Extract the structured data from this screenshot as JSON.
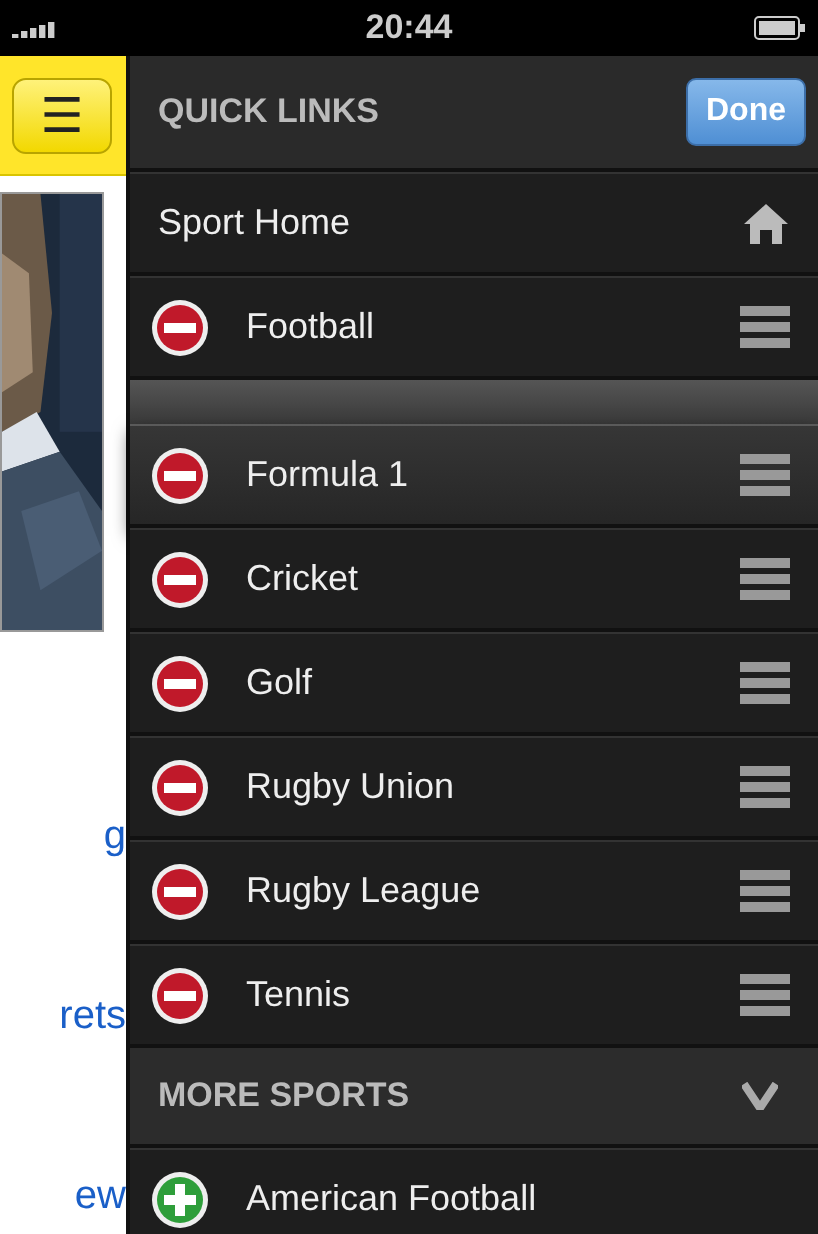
{
  "status_bar": {
    "time": "20:44"
  },
  "left_page": {
    "menu_button": "☰",
    "links": [
      "g",
      "rets",
      "ew"
    ]
  },
  "quick_links": {
    "title": "QUICK LINKS",
    "done_button": "Done",
    "home": {
      "label": "Sport Home"
    },
    "items": [
      {
        "label": "Football",
        "dragging": false
      },
      {
        "label": "Formula 1",
        "dragging": true
      },
      {
        "label": "Cricket",
        "dragging": false
      },
      {
        "label": "Golf",
        "dragging": false
      },
      {
        "label": "Rugby Union",
        "dragging": false
      },
      {
        "label": "Rugby League",
        "dragging": false
      },
      {
        "label": "Tennis",
        "dragging": false
      }
    ]
  },
  "more_sports": {
    "title": "MORE SPORTS",
    "expanded": true,
    "items": [
      {
        "label": "American Football"
      }
    ]
  }
}
